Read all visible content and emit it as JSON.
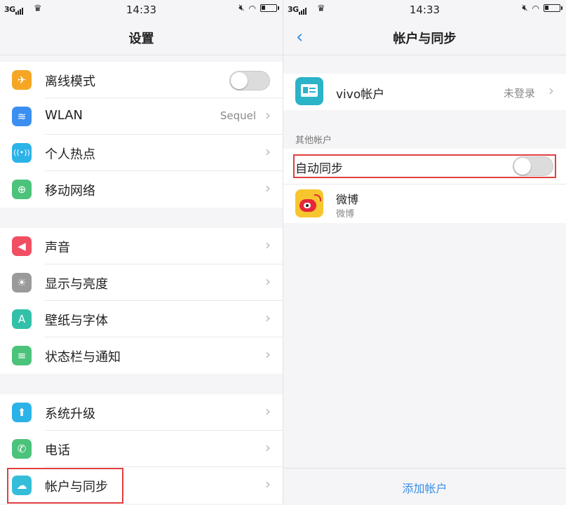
{
  "statusbar": {
    "network": "3G",
    "time": "14:33"
  },
  "left": {
    "title": "设置",
    "group1": [
      {
        "label": "离线模式",
        "icon": "airplane-icon",
        "color": "#f5a623"
      },
      {
        "label": "WLAN",
        "icon": "wifi-icon",
        "color": "#3b8ff0",
        "value": "Sequel"
      },
      {
        "label": "个人热点",
        "icon": "hotspot-icon",
        "color": "#2bb3e8"
      },
      {
        "label": "移动网络",
        "icon": "globe-icon",
        "color": "#4cc37b"
      }
    ],
    "group2": [
      {
        "label": "声音",
        "icon": "speaker-icon",
        "color": "#f24e62"
      },
      {
        "label": "显示与亮度",
        "icon": "brightness-icon",
        "color": "#9a9a9a"
      },
      {
        "label": "壁纸与字体",
        "icon": "font-icon",
        "color": "#33c0a8"
      },
      {
        "label": "状态栏与通知",
        "icon": "list-icon",
        "color": "#4cc37b"
      }
    ],
    "group3": [
      {
        "label": "系统升级",
        "icon": "upgrade-icon",
        "color": "#2bb3e8"
      },
      {
        "label": "电话",
        "icon": "phone-icon",
        "color": "#4cc37b"
      },
      {
        "label": "帐户与同步",
        "icon": "cloud-icon",
        "color": "#33bdd8"
      }
    ]
  },
  "right": {
    "title": "帐户与同步",
    "vivo_account": {
      "label": "vivo帐户",
      "status": "未登录"
    },
    "other_accounts_label": "其他帐户",
    "auto_sync_label": "自动同步",
    "weibo": {
      "name": "微博",
      "sub": "微博"
    },
    "add_account": "添加帐户"
  }
}
